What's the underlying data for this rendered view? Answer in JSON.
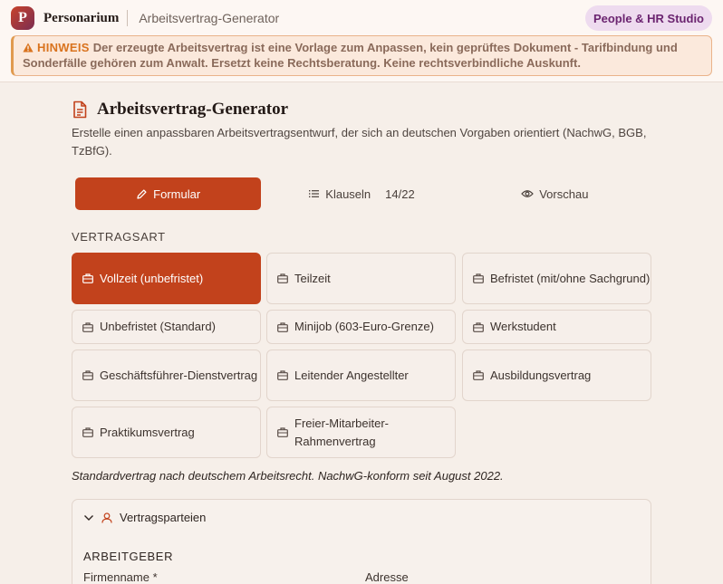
{
  "header": {
    "brand": "Personarium",
    "logo_letter": "P",
    "page": "Arbeitsvertrag-Generator",
    "studio_badge": "People & HR Studio"
  },
  "warning": {
    "tag": "HINWEIS",
    "text": "Der erzeugte Arbeitsvertrag ist eine Vorlage zum Anpassen, kein geprüftes Dokument - Tarifbindung und Sonderfälle gehören zum Anwalt. Ersetzt keine Rechtsberatung. Keine rechtsverbindliche Auskunft.",
    "color": "#e09a4e"
  },
  "main": {
    "title": "Arbeitsvertrag-Generator",
    "subtitle": "Erstelle einen anpassbaren Arbeitsvertragsentwurf, der sich an deutschen Vorgaben orientiert (NachwG, BGB, TzBfG).",
    "tabs": [
      {
        "label": "Formular",
        "icon": "pencil-icon",
        "active": true
      },
      {
        "label": "Klauseln",
        "icon": "list-icon",
        "count": "14/22"
      },
      {
        "label": "Vorschau",
        "icon": "eye-icon"
      }
    ],
    "contract_type_label": "VERTRAGSART",
    "contract_types": [
      {
        "label": "Vollzeit (unbefristet)",
        "active": true
      },
      {
        "label": "Teilzeit"
      },
      {
        "label": "Befristet (mit/ohne Sachgrund)"
      },
      {
        "label": "Unbefristet (Standard)"
      },
      {
        "label": "Minijob (603-Euro-Grenze)"
      },
      {
        "label": "Werkstudent"
      },
      {
        "label": "Geschäftsführer-Dienstvertrag"
      },
      {
        "label": "Leitender Angestellter"
      },
      {
        "label": "Ausbildungsvertrag"
      },
      {
        "label": "Praktikumsvertrag"
      },
      {
        "label": "Freier-Mitarbeiter-Rahmenvertrag"
      }
    ],
    "note": "Standardvertrag nach deutschem Arbeitsrecht. NachwG-konform seit August 2022.",
    "parties": {
      "title": "Vertragsparteien",
      "employer_label": "ARBEITGEBER",
      "company_name_label": "Firmenname *",
      "address_label": "Adresse"
    }
  },
  "colors": {
    "accent": "#c2421c",
    "badge_bg": "#eedbef",
    "badge_text": "#6b2470",
    "warning_tag": "#d9731e"
  }
}
